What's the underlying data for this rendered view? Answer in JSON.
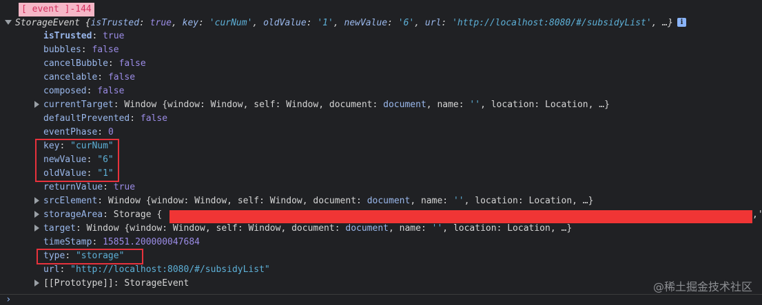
{
  "log_tag": "[ event ]-144",
  "summary": {
    "type_name": "StorageEvent",
    "open": "{",
    "k1": "isTrusted",
    "v1": "true",
    "k2": "key",
    "v2": "'curNum'",
    "k3": "oldValue",
    "v3": "'1'",
    "k4": "newValue",
    "v4": "'6'",
    "k5": "url",
    "v5": "'http://localhost:8080/#/subsidyList'",
    "tail": ", …}",
    "info_icon": "i"
  },
  "props": {
    "isTrusted": {
      "key": "isTrusted",
      "value": "true"
    },
    "bubbles": {
      "key": "bubbles",
      "value": "false"
    },
    "cancelBubble": {
      "key": "cancelBubble",
      "value": "false"
    },
    "cancelable": {
      "key": "cancelable",
      "value": "false"
    },
    "composed": {
      "key": "composed",
      "value": "false"
    },
    "currentTarget": {
      "key": "currentTarget",
      "value_type": "Window",
      "open": "{",
      "k1": "window",
      "v1": "Window",
      "k2": "self",
      "v2": "Window",
      "k3": "document",
      "v3": "document",
      "k4": "name",
      "v4": "''",
      "k5": "location",
      "v5": "Location",
      "tail": ", …}"
    },
    "defaultPrevented": {
      "key": "defaultPrevented",
      "value": "false"
    },
    "eventPhase": {
      "key": "eventPhase",
      "value": "0"
    },
    "key": {
      "key": "key",
      "value": "\"curNum\""
    },
    "newValue": {
      "key": "newValue",
      "value": "\"6\""
    },
    "oldValue": {
      "key": "oldValue",
      "value": "\"1\""
    },
    "returnValue": {
      "key": "returnValue",
      "value": "true"
    },
    "srcElement": {
      "key": "srcElement",
      "value_type": "Window",
      "open": "{",
      "k1": "window",
      "v1": "Window",
      "k2": "self",
      "v2": "Window",
      "k3": "document",
      "v3": "document",
      "k4": "name",
      "v4": "''",
      "k5": "location",
      "v5": "Location",
      "tail": ", …}"
    },
    "storageArea": {
      "key": "storageArea",
      "value_type": "Storage",
      "open": "{",
      "tail_quote": ",'"
    },
    "target": {
      "key": "target",
      "value_type": "Window",
      "open": "{",
      "k1": "window",
      "v1": "Window",
      "k2": "self",
      "v2": "Window",
      "k3": "document",
      "v3": "document",
      "k4": "name",
      "v4": "''",
      "k5": "location",
      "v5": "Location",
      "tail": ", …}"
    },
    "timeStamp": {
      "key": "timeStamp",
      "value": "15851.200000047684"
    },
    "type": {
      "key": "type",
      "value": "\"storage\""
    },
    "url": {
      "key": "url",
      "value": "\"http://localhost:8080/#/subsidyList\""
    },
    "prototype": {
      "key": "[[Prototype]]",
      "value": "StorageEvent"
    }
  },
  "watermark": "@稀土掘金技术社区",
  "prompt_symbol": "›",
  "colors": {
    "background": "#202124",
    "highlight_border": "#e8323c",
    "redaction": "#f03535",
    "tag_background": "#f5b7c7",
    "tag_text": "#d3305f"
  }
}
